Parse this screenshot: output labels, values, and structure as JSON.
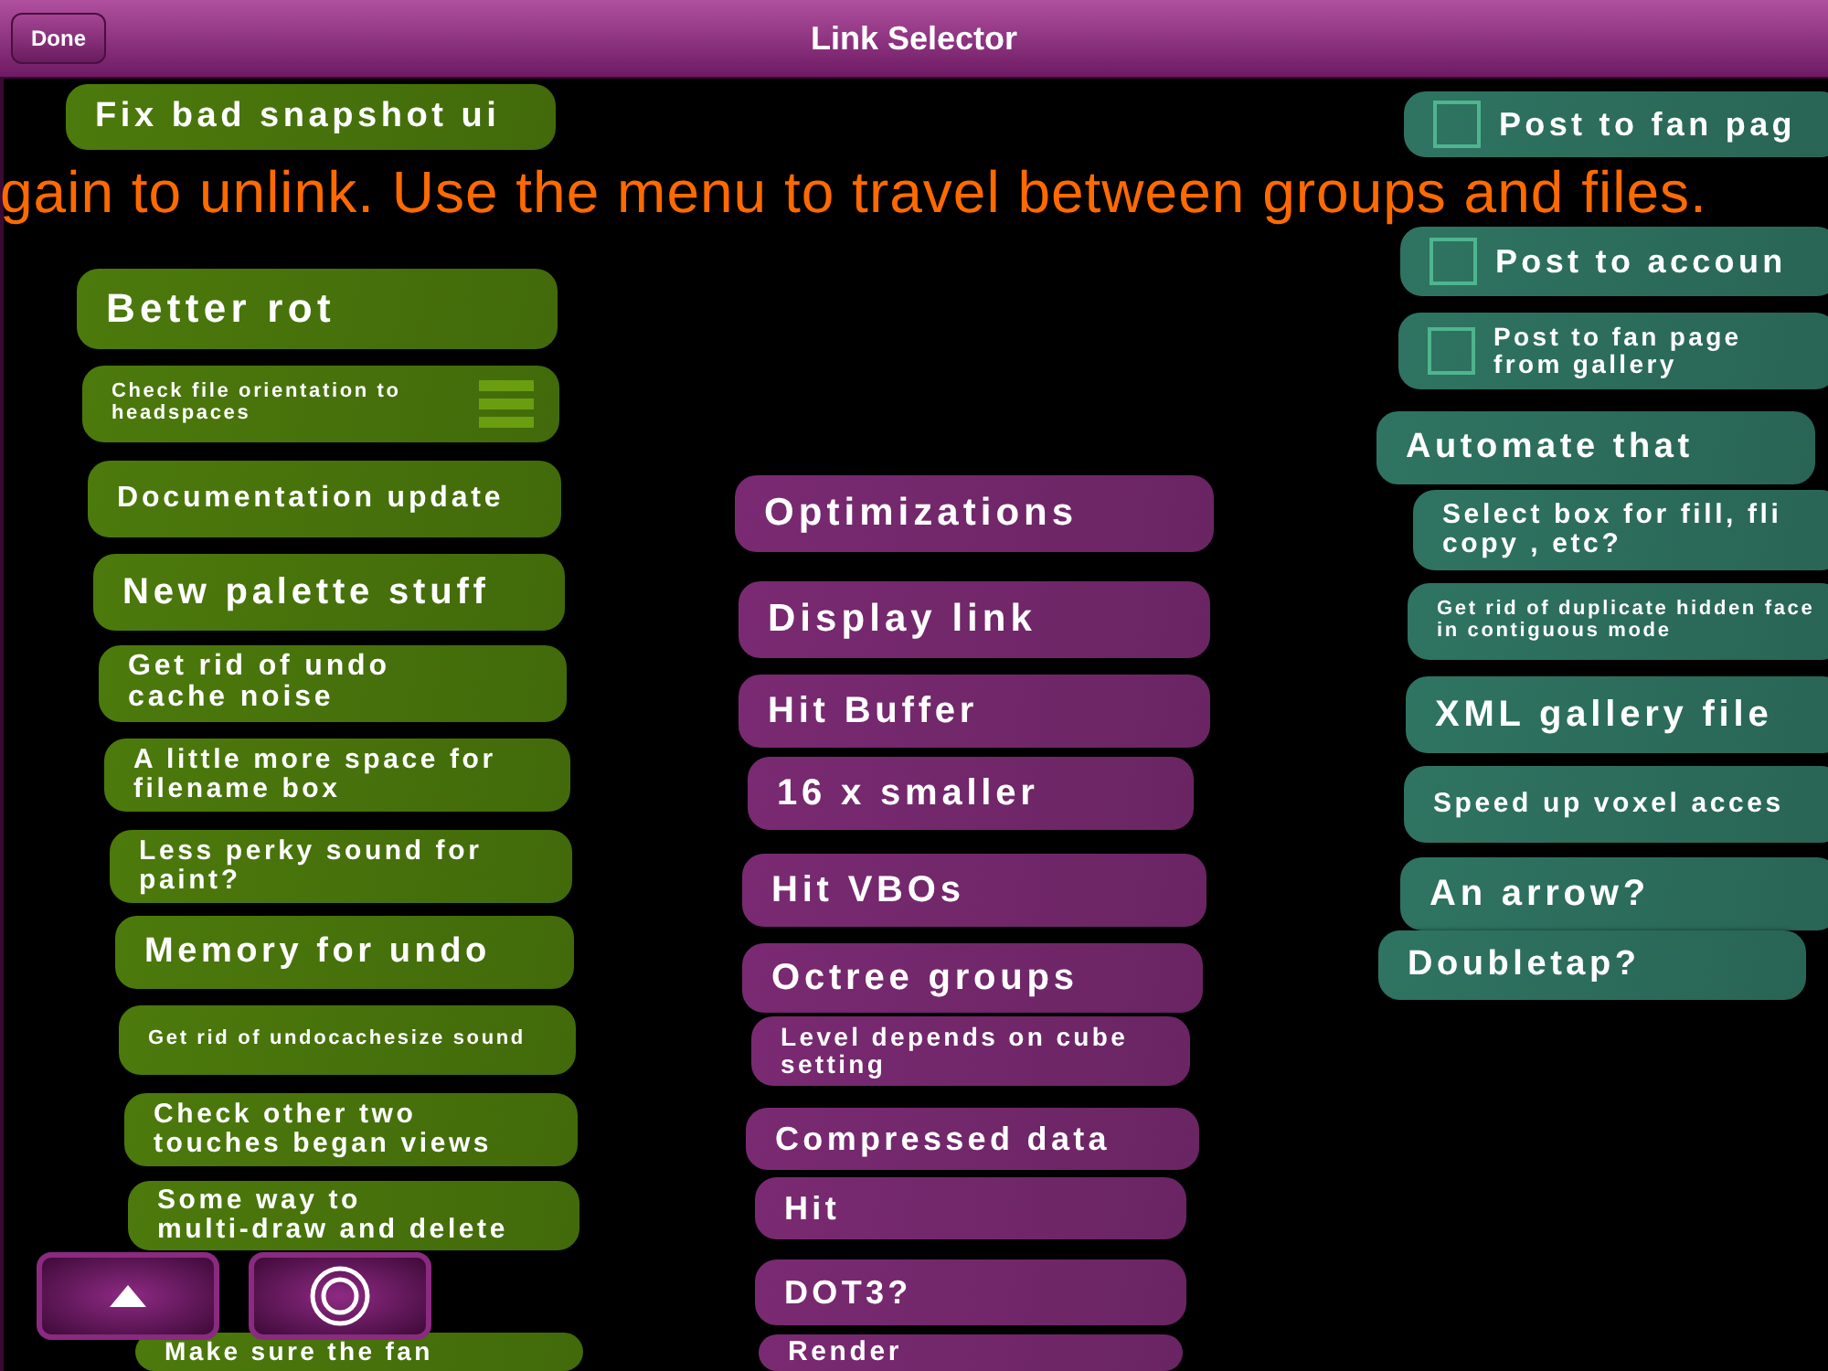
{
  "header": {
    "done_button": "Done",
    "title": "Link Selector"
  },
  "banner": "gain to unlink. Use the menu to travel between groups and files.",
  "groups": [
    {
      "color": "#4c7a0c",
      "cards": [
        {
          "kind": "plain",
          "text": "Fix bad snapshot ui"
        },
        {
          "kind": "plain",
          "text": "Better rot"
        },
        {
          "kind": "reorder",
          "text": "Check file orientation to\nheadspaces"
        },
        {
          "kind": "plain",
          "text": "Documentation update"
        },
        {
          "kind": "plain",
          "text": "New palette stuff"
        },
        {
          "kind": "plain",
          "text": "Get rid of undo\ncache noise"
        },
        {
          "kind": "plain",
          "text": "A little more space for\nfilename box"
        },
        {
          "kind": "plain",
          "text": "Less perky sound for\npaint?"
        },
        {
          "kind": "plain",
          "text": "Memory for undo"
        },
        {
          "kind": "plain",
          "text": "Get rid of undocachesize sound"
        },
        {
          "kind": "plain",
          "text": "Check other two\ntouches began views"
        },
        {
          "kind": "plain",
          "text": "Some way to\nmulti-draw and delete"
        },
        {
          "kind": "plain",
          "text": "Make sure the fan"
        }
      ]
    },
    {
      "color": "#7a2a72",
      "cards": [
        {
          "kind": "plain",
          "text": "Optimizations"
        },
        {
          "kind": "plain",
          "text": "Display link"
        },
        {
          "kind": "plain",
          "text": "Hit Buffer"
        },
        {
          "kind": "plain",
          "text": "16 x smaller"
        },
        {
          "kind": "plain",
          "text": "Hit VBOs"
        },
        {
          "kind": "plain",
          "text": "Octree groups"
        },
        {
          "kind": "plain",
          "text": "Level depends on cube\nsetting"
        },
        {
          "kind": "plain",
          "text": "Compressed data"
        },
        {
          "kind": "plain",
          "text": "Hit"
        },
        {
          "kind": "plain",
          "text": "DOT3?"
        },
        {
          "kind": "plain",
          "text": "Render"
        }
      ]
    },
    {
      "color": "#2f7462",
      "cards": [
        {
          "kind": "checkbox",
          "checked": false,
          "text": "Post to fan pag"
        },
        {
          "kind": "checkbox",
          "checked": false,
          "text": "Post to accoun"
        },
        {
          "kind": "checkbox",
          "checked": false,
          "text": "Post to fan page\nfrom gallery"
        },
        {
          "kind": "plain",
          "text": "Automate that"
        },
        {
          "kind": "plain",
          "text": "Select box for fill, fli\ncopy , etc?"
        },
        {
          "kind": "plain",
          "text": "Get rid of duplicate hidden face\nin contiguous mode"
        },
        {
          "kind": "plain",
          "text": "XML gallery file"
        },
        {
          "kind": "plain",
          "text": "Speed up voxel acces"
        },
        {
          "kind": "plain",
          "text": "An arrow?"
        },
        {
          "kind": "plain",
          "text": "Doubletap?"
        }
      ]
    }
  ]
}
